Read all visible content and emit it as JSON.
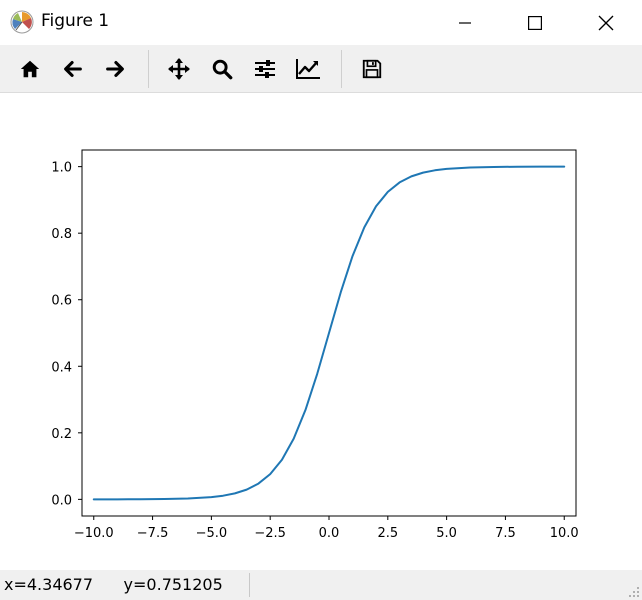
{
  "window": {
    "title": "Figure 1",
    "app_icon": "matplotlib-icon",
    "controls": [
      "minimize-icon",
      "maximize-icon",
      "close-icon"
    ]
  },
  "toolbar": {
    "buttons": [
      {
        "name": "home",
        "icon": "home-icon"
      },
      {
        "name": "back",
        "icon": "arrow-left-icon"
      },
      {
        "name": "forward",
        "icon": "arrow-right-icon"
      },
      {
        "name": "pan",
        "icon": "move-icon"
      },
      {
        "name": "zoom",
        "icon": "magnifier-icon"
      },
      {
        "name": "configure-subplots",
        "icon": "sliders-icon"
      },
      {
        "name": "edit-axis",
        "icon": "line-chart-icon"
      },
      {
        "name": "save",
        "icon": "floppy-disk-icon"
      }
    ]
  },
  "status": {
    "coordinates": "x=4.34677      y=0.751205"
  },
  "chart_data": {
    "type": "line",
    "title": "",
    "xlabel": "",
    "ylabel": "",
    "xlim": [
      -10.5,
      10.5
    ],
    "ylim": [
      -0.05,
      1.05
    ],
    "xticks": [
      -10.0,
      -7.5,
      -5.0,
      -2.5,
      0.0,
      2.5,
      5.0,
      7.5,
      10.0
    ],
    "xtick_labels": [
      "−10.0",
      "−7.5",
      "−5.0",
      "−2.5",
      "0.0",
      "2.5",
      "5.0",
      "7.5",
      "10.0"
    ],
    "yticks": [
      0.0,
      0.2,
      0.4,
      0.6,
      0.8,
      1.0
    ],
    "ytick_labels": [
      "0.0",
      "0.2",
      "0.4",
      "0.6",
      "0.8",
      "1.0"
    ],
    "grid": false,
    "series": [
      {
        "color": "#1f77b4",
        "x": [
          -10,
          -9,
          -8,
          -7,
          -6,
          -5,
          -4.5,
          -4,
          -3.5,
          -3,
          -2.5,
          -2,
          -1.5,
          -1,
          -0.5,
          0,
          0.5,
          1,
          1.5,
          2,
          2.5,
          3,
          3.5,
          4,
          4.5,
          5,
          6,
          7,
          8,
          9,
          10
        ],
        "y": [
          0.0,
          0.0001,
          0.0003,
          0.0009,
          0.0025,
          0.0067,
          0.011,
          0.018,
          0.0293,
          0.0474,
          0.0759,
          0.1192,
          0.1824,
          0.2689,
          0.3775,
          0.5,
          0.6225,
          0.7311,
          0.8176,
          0.8808,
          0.9241,
          0.9526,
          0.9707,
          0.982,
          0.989,
          0.9933,
          0.9975,
          0.9991,
          0.9997,
          0.9999,
          1.0
        ]
      }
    ]
  }
}
